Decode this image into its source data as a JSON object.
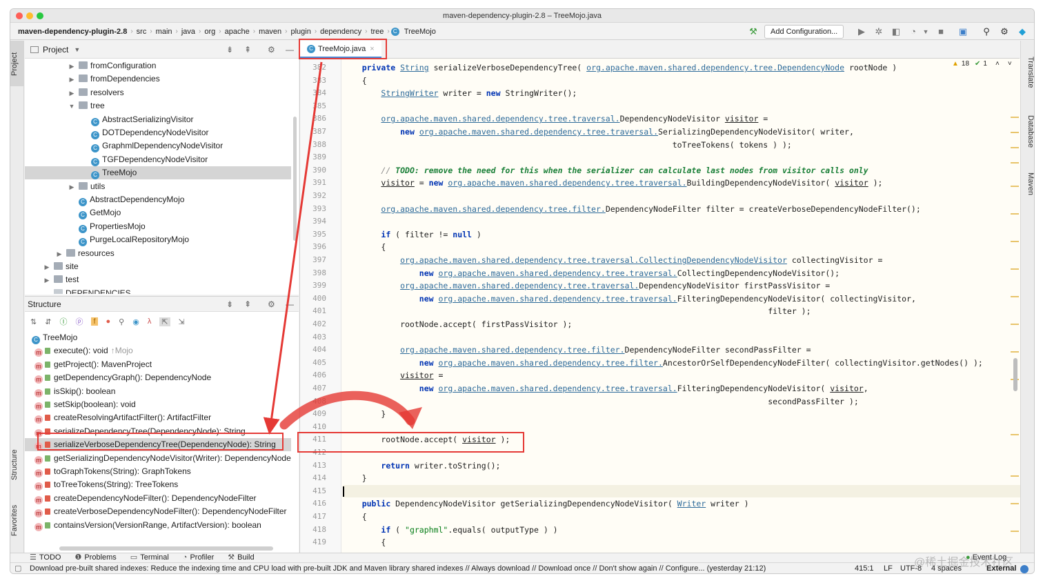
{
  "window": {
    "title": "maven-dependency-plugin-2.8 – TreeMojo.java"
  },
  "breadcrumbs": [
    "maven-dependency-plugin-2.8",
    "src",
    "main",
    "java",
    "org",
    "apache",
    "maven",
    "plugin",
    "dependency",
    "tree",
    "TreeMojo"
  ],
  "toolbar": {
    "add_config": "Add Configuration..."
  },
  "left_tool_tabs": {
    "project": "Project",
    "structure": "Structure",
    "favorites": "Favorites"
  },
  "right_tool_tabs": {
    "translate": "Translate",
    "database": "Database",
    "maven": "Maven"
  },
  "project_panel": {
    "title": "Project",
    "items": [
      {
        "label": "fromConfiguration",
        "type": "folder",
        "indent": 1,
        "arrow": "▶"
      },
      {
        "label": "fromDependencies",
        "type": "folder",
        "indent": 1,
        "arrow": "▶"
      },
      {
        "label": "resolvers",
        "type": "folder",
        "indent": 1,
        "arrow": "▶"
      },
      {
        "label": "tree",
        "type": "folder",
        "indent": 1,
        "arrow": "▼"
      },
      {
        "label": "AbstractSerializingVisitor",
        "type": "class",
        "indent": 2
      },
      {
        "label": "DOTDependencyNodeVisitor",
        "type": "class",
        "indent": 2
      },
      {
        "label": "GraphmlDependencyNodeVisitor",
        "type": "class",
        "indent": 2
      },
      {
        "label": "TGFDependencyNodeVisitor",
        "type": "class",
        "indent": 2
      },
      {
        "label": "TreeMojo",
        "type": "class",
        "indent": 2,
        "selected": true
      },
      {
        "label": "utils",
        "type": "folder",
        "indent": 1,
        "arrow": "▶"
      },
      {
        "label": "AbstractDependencyMojo",
        "type": "class",
        "indent": 1
      },
      {
        "label": "GetMojo",
        "type": "class",
        "indent": 1
      },
      {
        "label": "PropertiesMojo",
        "type": "class",
        "indent": 1
      },
      {
        "label": "PurgeLocalRepositoryMojo",
        "type": "class",
        "indent": 1
      },
      {
        "label": "resources",
        "type": "folder",
        "indent": 0,
        "arrow": "▶"
      },
      {
        "label": "site",
        "type": "folder",
        "indent": -1,
        "arrow": "▶"
      },
      {
        "label": "test",
        "type": "folder",
        "indent": -1,
        "arrow": "▶"
      },
      {
        "label": "DEPENDENCIES",
        "type": "file",
        "indent": -1
      }
    ]
  },
  "structure_panel": {
    "title": "Structure",
    "root": "TreeMojo",
    "items": [
      {
        "label": "execute(): void",
        "suffix": "↑Mojo",
        "access": "public"
      },
      {
        "label": "getProject(): MavenProject",
        "access": "public"
      },
      {
        "label": "getDependencyGraph(): DependencyNode",
        "access": "public"
      },
      {
        "label": "isSkip(): boolean",
        "access": "public"
      },
      {
        "label": "setSkip(boolean): void",
        "access": "public"
      },
      {
        "label": "createResolvingArtifactFilter(): ArtifactFilter",
        "access": "private"
      },
      {
        "label": "serializeDependencyTree(DependencyNode): String",
        "access": "private"
      },
      {
        "label": "serializeVerboseDependencyTree(DependencyNode): String",
        "access": "private",
        "selected": true
      },
      {
        "label": "getSerializingDependencyNodeVisitor(Writer): DependencyNodeVisitor",
        "access": "public"
      },
      {
        "label": "toGraphTokens(String): GraphTokens",
        "access": "private"
      },
      {
        "label": "toTreeTokens(String): TreeTokens",
        "access": "private"
      },
      {
        "label": "createDependencyNodeFilter(): DependencyNodeFilter",
        "access": "private"
      },
      {
        "label": "createVerboseDependencyNodeFilter(): DependencyNodeFilter",
        "access": "private"
      },
      {
        "label": "containsVersion(VersionRange, ArtifactVersion): boolean",
        "access": "public"
      }
    ]
  },
  "editor": {
    "tab": "TreeMojo.java",
    "warnings": "18",
    "checks": "1",
    "lines": [
      {
        "n": "382",
        "html": "    <span class='kw'>private</span> <span class='pkg'>String</span> serializeVerboseDependencyTree( <span class='pkg'>org.apache.maven.shared.dependency.tree.DependencyNode</span> rootNode )"
      },
      {
        "n": "383",
        "html": "    {"
      },
      {
        "n": "384",
        "html": "        <span class='pkg'>StringWriter</span> writer = <span class='kw'>new</span> StringWriter();"
      },
      {
        "n": "385",
        "html": ""
      },
      {
        "n": "386",
        "html": "        <span class='pkg'>org.apache.maven.shared.dependency.tree.traversal.</span>DependencyNodeVisitor <span style='text-decoration:underline'>visitor</span> ="
      },
      {
        "n": "387",
        "html": "            <span class='kw'>new</span> <span class='pkg'>org.apache.maven.shared.dependency.tree.traversal.</span>SerializingDependencyNodeVisitor( writer,"
      },
      {
        "n": "388",
        "html": "                                                                     toTreeTokens( tokens ) );"
      },
      {
        "n": "389",
        "html": ""
      },
      {
        "n": "390",
        "html": "        <span class='cm'>// </span><span class='todo'>TODO: remove the need for this when the serializer can calculate last nodes from visitor calls only</span>"
      },
      {
        "n": "391",
        "html": "        <span style='text-decoration:underline'>visitor</span> = <span class='kw'>new</span> <span class='pkg'>org.apache.maven.shared.dependency.tree.traversal.</span>BuildingDependencyNodeVisitor( <span style='text-decoration:underline'>visitor</span> );"
      },
      {
        "n": "392",
        "html": ""
      },
      {
        "n": "393",
        "html": "        <span class='pkg'>org.apache.maven.shared.dependency.tree.filter.</span>DependencyNodeFilter filter = createVerboseDependencyNodeFilter();"
      },
      {
        "n": "394",
        "html": ""
      },
      {
        "n": "395",
        "html": "        <span class='kw'>if</span> ( filter != <span class='kw'>null</span> )"
      },
      {
        "n": "396",
        "html": "        {"
      },
      {
        "n": "397",
        "html": "            <span class='pkg'>org.apache.maven.shared.dependency.tree.traversal.CollectingDependencyNodeVisitor</span> collectingVisitor ="
      },
      {
        "n": "398",
        "html": "                <span class='kw'>new</span> <span class='pkg'>org.apache.maven.shared.dependency.tree.traversal.</span>CollectingDependencyNodeVisitor();"
      },
      {
        "n": "399",
        "html": "            <span class='pkg'>org.apache.maven.shared.dependency.tree.traversal.</span>DependencyNodeVisitor firstPassVisitor ="
      },
      {
        "n": "400",
        "html": "                <span class='kw'>new</span> <span class='pkg'>org.apache.maven.shared.dependency.tree.traversal.</span>FilteringDependencyNodeVisitor( collectingVisitor,"
      },
      {
        "n": "401",
        "html": "                                                                                         filter );"
      },
      {
        "n": "402",
        "html": "            rootNode.accept( firstPassVisitor );"
      },
      {
        "n": "403",
        "html": ""
      },
      {
        "n": "404",
        "html": "            <span class='pkg'>org.apache.maven.shared.dependency.tree.filter.</span>DependencyNodeFilter secondPassFilter ="
      },
      {
        "n": "405",
        "html": "                <span class='kw'>new</span> <span class='pkg'>org.apache.maven.shared.dependency.tree.filter.</span>AncestorOrSelfDependencyNodeFilter( collectingVisitor.getNodes() );"
      },
      {
        "n": "406",
        "html": "            <span style='text-decoration:underline'>visitor</span> ="
      },
      {
        "n": "407",
        "html": "                <span class='kw'>new</span> <span class='pkg'>org.apache.maven.shared.dependency.tree.traversal.</span>FilteringDependencyNodeVisitor( <span style='text-decoration:underline'>visitor</span>,"
      },
      {
        "n": "408",
        "html": "                                                                                         secondPassFilter );"
      },
      {
        "n": "409",
        "html": "        }"
      },
      {
        "n": "410",
        "html": ""
      },
      {
        "n": "411",
        "html": "        rootNode.accept( <span style='text-decoration:underline'>visitor</span> );"
      },
      {
        "n": "412",
        "html": ""
      },
      {
        "n": "413",
        "html": "        <span class='kw'>return</span> writer.toString();"
      },
      {
        "n": "414",
        "html": "    }"
      },
      {
        "n": "415",
        "html": ""
      },
      {
        "n": "416",
        "html": "    <span class='kw'>public</span> DependencyNodeVisitor getSerializingDependencyNodeVisitor( <span class='pkg'>Writer</span> writer )"
      },
      {
        "n": "417",
        "html": "    {"
      },
      {
        "n": "418",
        "html": "        <span class='kw'>if</span> ( <span class='str'>\"graphml\"</span>.equals( outputType ) )"
      },
      {
        "n": "419",
        "html": "        {"
      }
    ]
  },
  "bottom_tabs": [
    "TODO",
    "Problems",
    "Terminal",
    "Profiler",
    "Build"
  ],
  "event_log": "Event Log",
  "status": {
    "message": "Download pre-built shared indexes: Reduce the indexing time and CPU load with pre-built JDK and Maven library shared indexes // Always download // Download once // Don't show again // Configure... (yesterday 21:12)",
    "position": "415:1",
    "line_sep": "LF",
    "encoding": "UTF-8",
    "indent": "4 spaces",
    "branch": "External",
    "watermark": "@稀土掘金技术社区"
  }
}
